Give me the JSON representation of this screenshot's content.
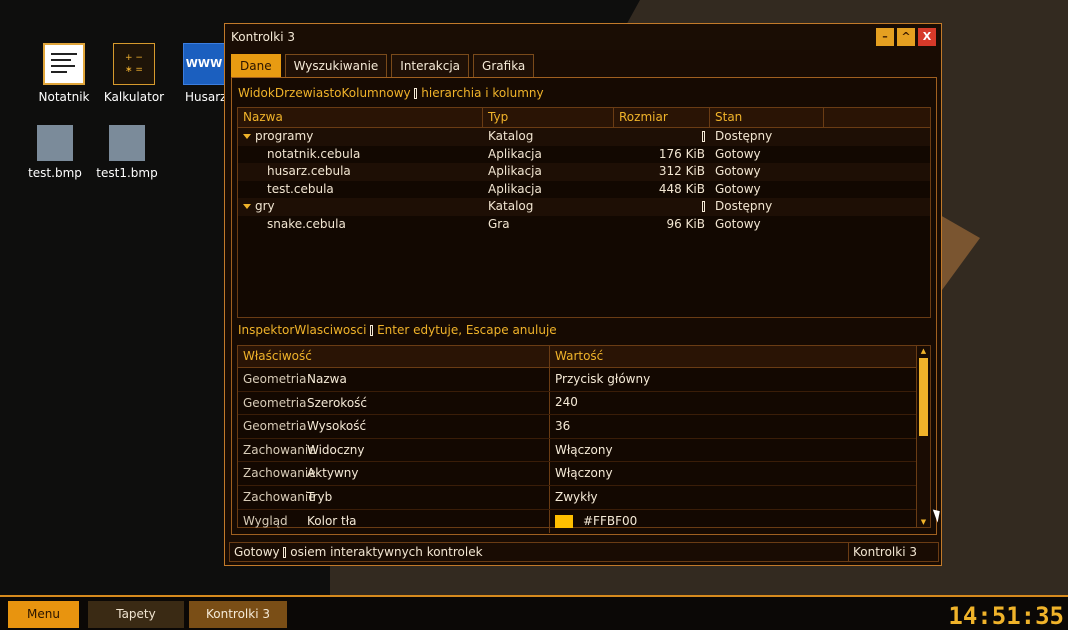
{
  "desktop": {
    "icons": [
      {
        "label": "Notatnik",
        "icon": "notepad-icon"
      },
      {
        "label": "Kalkulator",
        "icon": "calculator-icon",
        "glyph": "+ −\n∗ ="
      },
      {
        "label": "Husarz",
        "icon": "browser-icon",
        "glyph": "WWW"
      },
      {
        "label": "test.bmp",
        "icon": "image-file-icon"
      },
      {
        "label": "test1.bmp",
        "icon": "image-file-icon"
      }
    ]
  },
  "window": {
    "title": "Kontrolki 3",
    "buttons": {
      "minimize": "–",
      "maximize": "^",
      "close": "X"
    },
    "tabs": [
      {
        "label": "Dane",
        "active": true
      },
      {
        "label": "Wyszukiwanie",
        "active": false
      },
      {
        "label": "Interakcja",
        "active": false
      },
      {
        "label": "Grafika",
        "active": false
      }
    ],
    "tree_section": {
      "name": "WidokDrzewiastoKolumnowy",
      "hint": "hierarchia i kolumny"
    },
    "tree": {
      "columns": [
        "Nazwa",
        "Typ",
        "Rozmiar",
        "Stan"
      ],
      "rows": [
        {
          "name": "programy",
          "type": "Katalog",
          "size": "",
          "state": "Dostępny",
          "folder": true
        },
        {
          "name": "notatnik.cebula",
          "type": "Aplikacja",
          "size": "176 KiB",
          "state": "Gotowy",
          "folder": false
        },
        {
          "name": "husarz.cebula",
          "type": "Aplikacja",
          "size": "312 KiB",
          "state": "Gotowy",
          "folder": false
        },
        {
          "name": "test.cebula",
          "type": "Aplikacja",
          "size": "448 KiB",
          "state": "Gotowy",
          "folder": false
        },
        {
          "name": "gry",
          "type": "Katalog",
          "size": "",
          "state": "Dostępny",
          "folder": true
        },
        {
          "name": "snake.cebula",
          "type": "Gra",
          "size": "96 KiB",
          "state": "Gotowy",
          "folder": false
        }
      ]
    },
    "inspector_section": {
      "name": "InspektorWlasciwosci",
      "hint": "Enter edytuje, Escape anuluje"
    },
    "inspector": {
      "columns": [
        "Właściwość",
        "Wartość"
      ],
      "rows": [
        {
          "group": "Geometria",
          "prop": "Nazwa",
          "value": "Przycisk główny"
        },
        {
          "group": "Geometria",
          "prop": "Szerokość",
          "value": "240"
        },
        {
          "group": "Geometria",
          "prop": "Wysokość",
          "value": "36"
        },
        {
          "group": "Zachowanie",
          "prop": "Widoczny",
          "value": "Włączony"
        },
        {
          "group": "Zachowanie",
          "prop": "Aktywny",
          "value": "Włączony"
        },
        {
          "group": "Zachowanie",
          "prop": "Tryb",
          "value": "Zwykły"
        },
        {
          "group": "Wygląd",
          "prop": "Kolor tła",
          "value": "#FFBF00"
        }
      ]
    },
    "status": {
      "left": "Gotowy",
      "message": "osiem interaktywnych kontrolek",
      "right": "Kontrolki 3"
    }
  },
  "taskbar": {
    "menu": "Menu",
    "items": [
      "Tapety",
      "Kontrolki 3"
    ],
    "clock": "14:51:35"
  },
  "colors": {
    "accent": "#E89B12",
    "label": "#F0B32A",
    "border": "#C27A2A",
    "close": "#D63A2A"
  }
}
